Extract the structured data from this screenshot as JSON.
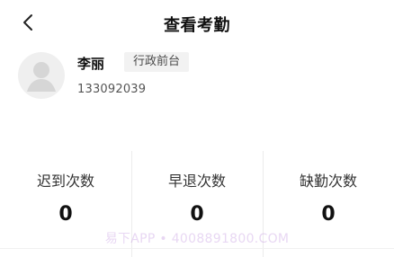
{
  "header": {
    "title": "查看考勤",
    "back_icon": "chevron-left-icon"
  },
  "profile": {
    "avatar_icon": "user-avatar-icon",
    "name": "李丽",
    "department": "行政前台",
    "phone": "133092039"
  },
  "stats": [
    {
      "label": "迟到次数",
      "value": "0"
    },
    {
      "label": "早退次数",
      "value": "0"
    },
    {
      "label": "缺勤次数",
      "value": "0"
    }
  ],
  "watermark": "易下APP • 4008891800.COM",
  "colors": {
    "background": "#ffffff",
    "text_primary": "#111111",
    "text_secondary": "#555555",
    "tag_bg": "#f2f2f2",
    "divider": "#ececec"
  }
}
